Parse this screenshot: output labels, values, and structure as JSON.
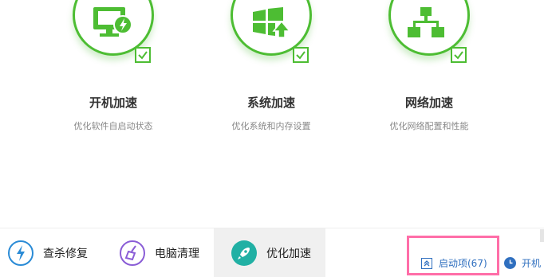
{
  "cards": [
    {
      "title": "开机加速",
      "desc": "优化软件自启动状态",
      "icon": "monitor-bolt-icon"
    },
    {
      "title": "系统加速",
      "desc": "优化系统和内存设置",
      "icon": "windows-upgrade-icon"
    },
    {
      "title": "网络加速",
      "desc": "优化网络配置和性能",
      "icon": "network-icon"
    }
  ],
  "tabs": [
    {
      "label": "查杀修复",
      "icon": "lightning-shield-icon",
      "color": "#2a8bd6"
    },
    {
      "label": "电脑清理",
      "icon": "broom-icon",
      "color": "#8a5dd6"
    },
    {
      "label": "优化加速",
      "icon": "rocket-icon",
      "color": "#21b0a4"
    }
  ],
  "bottom_links": {
    "startup_items": "启动项(67)",
    "boot_time": "开机"
  },
  "colors": {
    "accent": "#4dbd33",
    "highlight": "#ff6ea8",
    "link": "#2f6fbf"
  }
}
